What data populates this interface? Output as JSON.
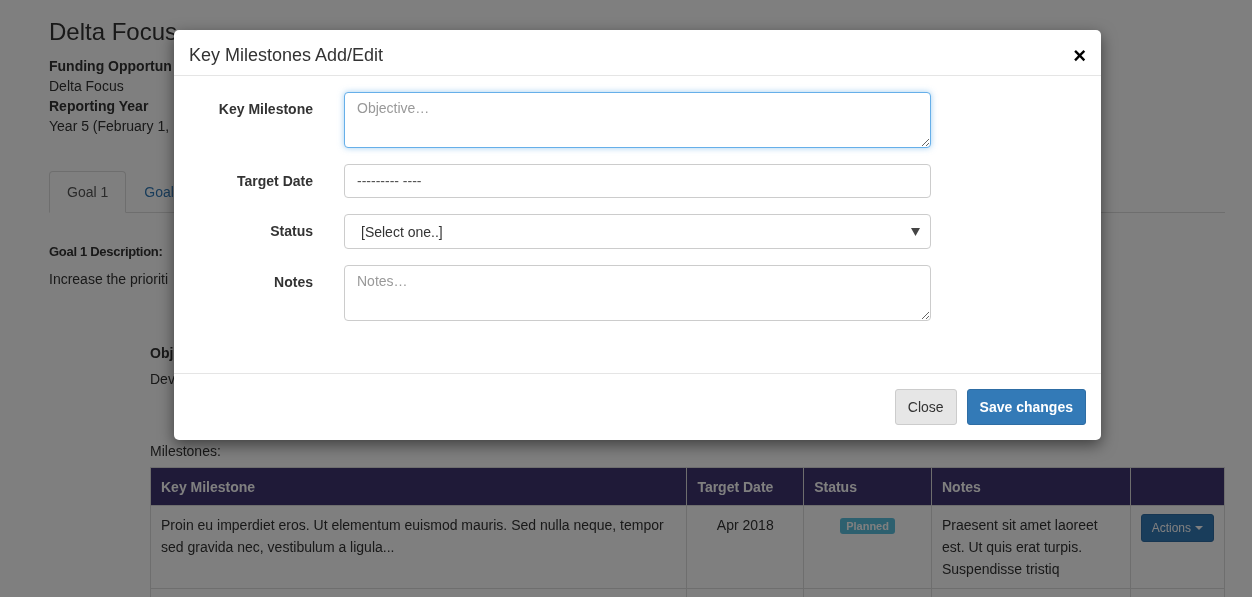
{
  "page": {
    "title": "Delta Focus",
    "meta": [
      {
        "kind": "label",
        "text": "Funding Opportun"
      },
      {
        "kind": "value",
        "text": "Delta Focus"
      },
      {
        "kind": "label",
        "text": "Reporting Year"
      },
      {
        "kind": "value",
        "text": "Year 5 (February 1,"
      }
    ],
    "tabs": [
      {
        "label": "Goal 1",
        "selected": true
      },
      {
        "label": "Goal",
        "selected": false
      }
    ],
    "goal_description_label": "Goal 1 Description:",
    "goal_description": "Increase the prioriti",
    "objective_label": "Obj",
    "objective_text": "Dev",
    "milestones_label": "Milestones:",
    "table": {
      "columns": [
        "Key Milestone",
        "Target Date",
        "Status",
        "Notes"
      ],
      "rows": [
        {
          "key_milestone": "Proin eu imperdiet eros. Ut elementum euismod mauris. Sed nulla neque, tempor sed gravida nec, vestibulum a ligula...",
          "target_date": "Apr 2018",
          "status": "Planned",
          "notes": "Praesent sit amet laoreet est. Ut quis erat turpis. Suspendisse tristiq",
          "action": "Actions"
        }
      ]
    }
  },
  "modal": {
    "title": "Key Milestones Add/Edit",
    "close": "×",
    "fields": [
      {
        "kind": "textarea",
        "label": "Key Milestone",
        "placeholder": "Objective…",
        "focused": true
      },
      {
        "kind": "date",
        "label": "Target Date",
        "value": "--------- ----",
        "focused": false
      },
      {
        "kind": "select",
        "label": "Status",
        "value": "[Select one..]",
        "focused": false
      },
      {
        "kind": "textarea",
        "label": "Notes",
        "placeholder": "Notes…",
        "focused": false
      }
    ],
    "buttons": [
      {
        "label": "Close",
        "kind": "default"
      },
      {
        "label": "Save changes",
        "kind": "primary"
      }
    ]
  }
}
